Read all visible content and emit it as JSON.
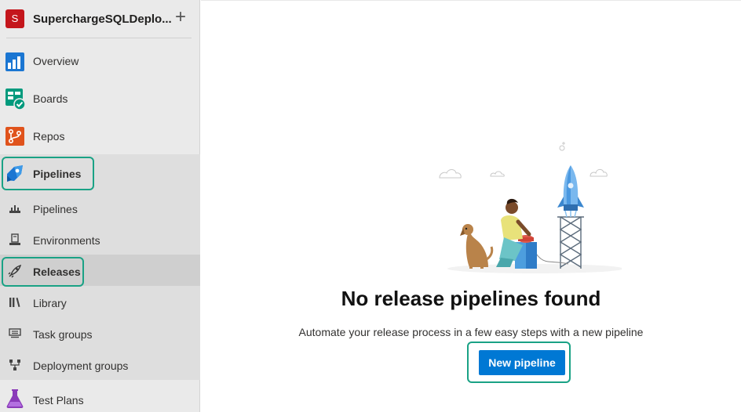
{
  "project": {
    "initial": "S",
    "name": "SuperchargeSQLDeplo...",
    "add_symbol": "+"
  },
  "nav": {
    "overview": "Overview",
    "boards": "Boards",
    "repos": "Repos",
    "pipelines_header": "Pipelines",
    "pipelines": "Pipelines",
    "environments": "Environments",
    "releases": "Releases",
    "library": "Library",
    "task_groups": "Task groups",
    "deployment_groups": "Deployment groups",
    "test_plans": "Test Plans"
  },
  "empty_state": {
    "title": "No release pipelines found",
    "subtitle": "Automate your release process in a few easy steps with a new pipeline",
    "button": "New pipeline"
  },
  "colors": {
    "accent": "#0078d4",
    "highlight": "#1aa285",
    "project_badge": "#c4161c"
  }
}
